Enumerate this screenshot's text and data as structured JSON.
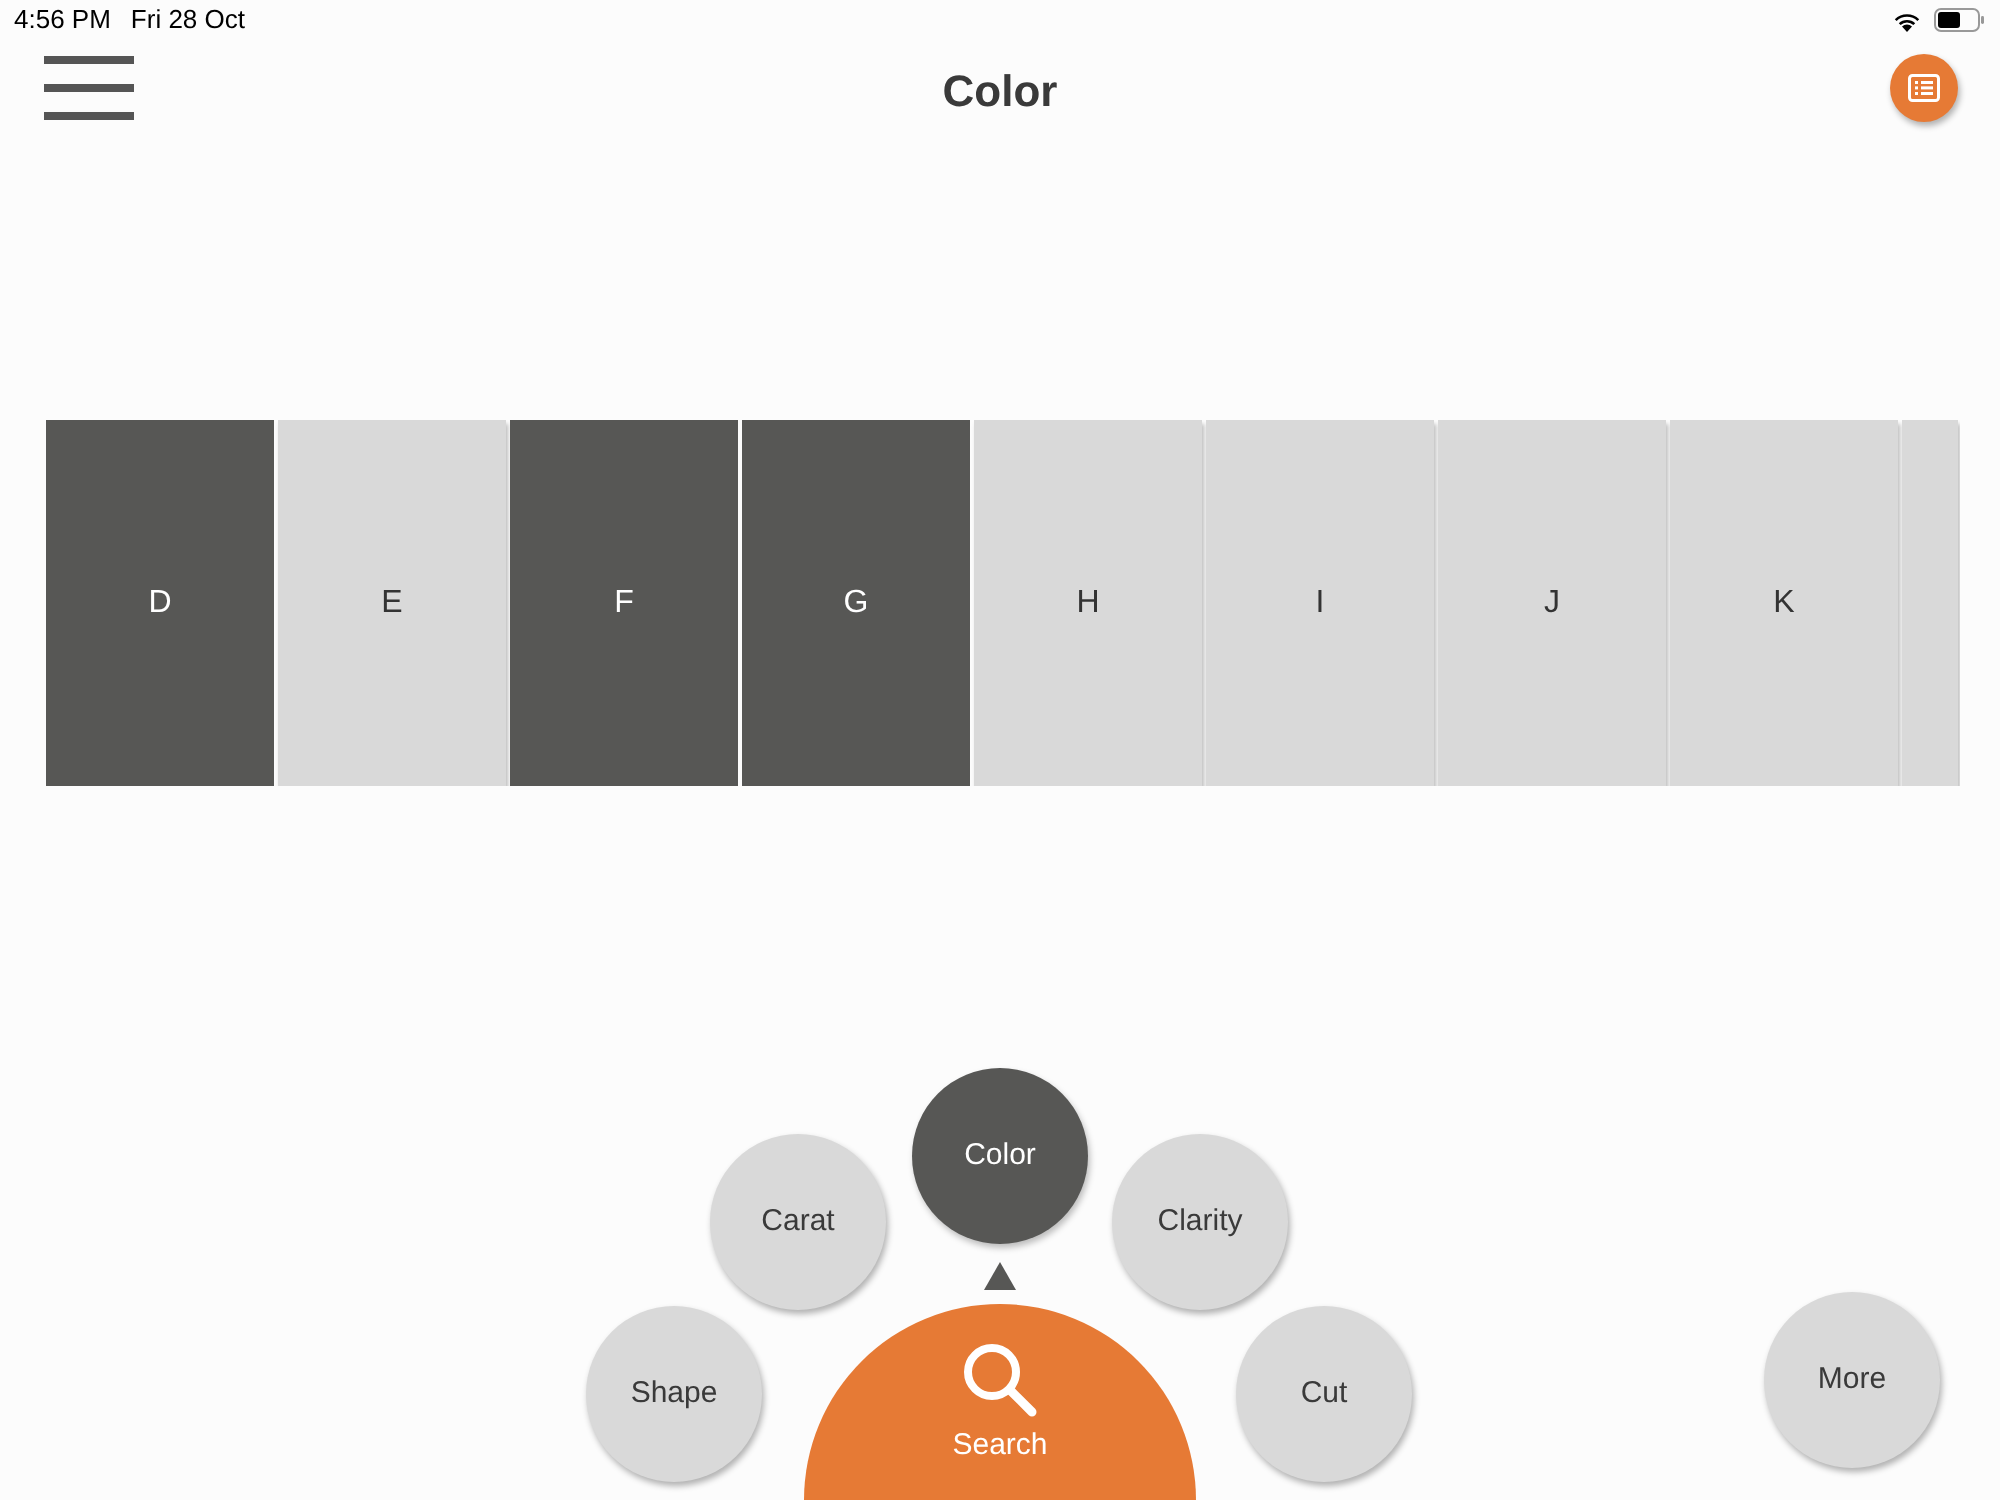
{
  "status_bar": {
    "time": "4:56 PM",
    "date": "Fri 28 Oct"
  },
  "header": {
    "title": "Color"
  },
  "grades": [
    {
      "label": "D",
      "selected": true
    },
    {
      "label": "E",
      "selected": false
    },
    {
      "label": "F",
      "selected": true
    },
    {
      "label": "G",
      "selected": true
    },
    {
      "label": "H",
      "selected": false
    },
    {
      "label": "I",
      "selected": false
    },
    {
      "label": "J",
      "selected": false
    },
    {
      "label": "K",
      "selected": false
    }
  ],
  "filter_menu": [
    {
      "label": "Shape",
      "selected": false
    },
    {
      "label": "Carat",
      "selected": false
    },
    {
      "label": "Color",
      "selected": true
    },
    {
      "label": "Clarity",
      "selected": false
    },
    {
      "label": "Cut",
      "selected": false
    }
  ],
  "search_button": {
    "label": "Search"
  },
  "more_button": {
    "label": "More"
  }
}
